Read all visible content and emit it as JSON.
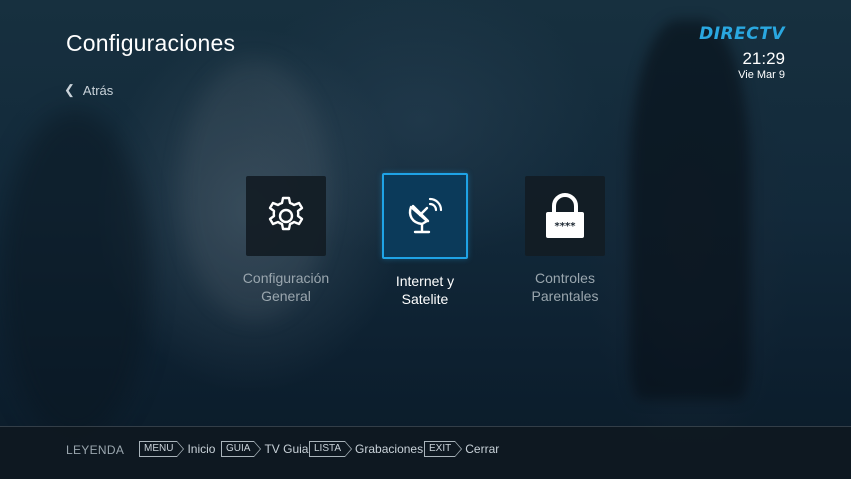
{
  "header": {
    "title": "Configuraciones",
    "back_label": "Atrás"
  },
  "brand": {
    "logo_text": "DIRECTV",
    "time": "21:29",
    "date": "Vie Mar 9",
    "accent_color": "#2aa8e0"
  },
  "menu": {
    "selected_index": 1,
    "items": [
      {
        "label_line1": "Configuración",
        "label_line2": "General",
        "icon": "gear-icon"
      },
      {
        "label_line1": "Internet y",
        "label_line2": "Satelite",
        "icon": "satellite-dish-icon"
      },
      {
        "label_line1": "Controles",
        "label_line2": "Parentales",
        "icon": "lock-icon",
        "icon_text": "****"
      }
    ]
  },
  "footer": {
    "legend": "LEYENDA",
    "hints": [
      {
        "key": "MENU",
        "label": "Inicio"
      },
      {
        "key": "GUIA",
        "label": "TV Guia"
      },
      {
        "key": "LISTA",
        "label": "Grabaciones"
      },
      {
        "key": "EXIT",
        "label": "Cerrar"
      }
    ]
  },
  "colors": {
    "selection_border": "#1fa3e6",
    "selection_fill": "#0b3a5a"
  }
}
